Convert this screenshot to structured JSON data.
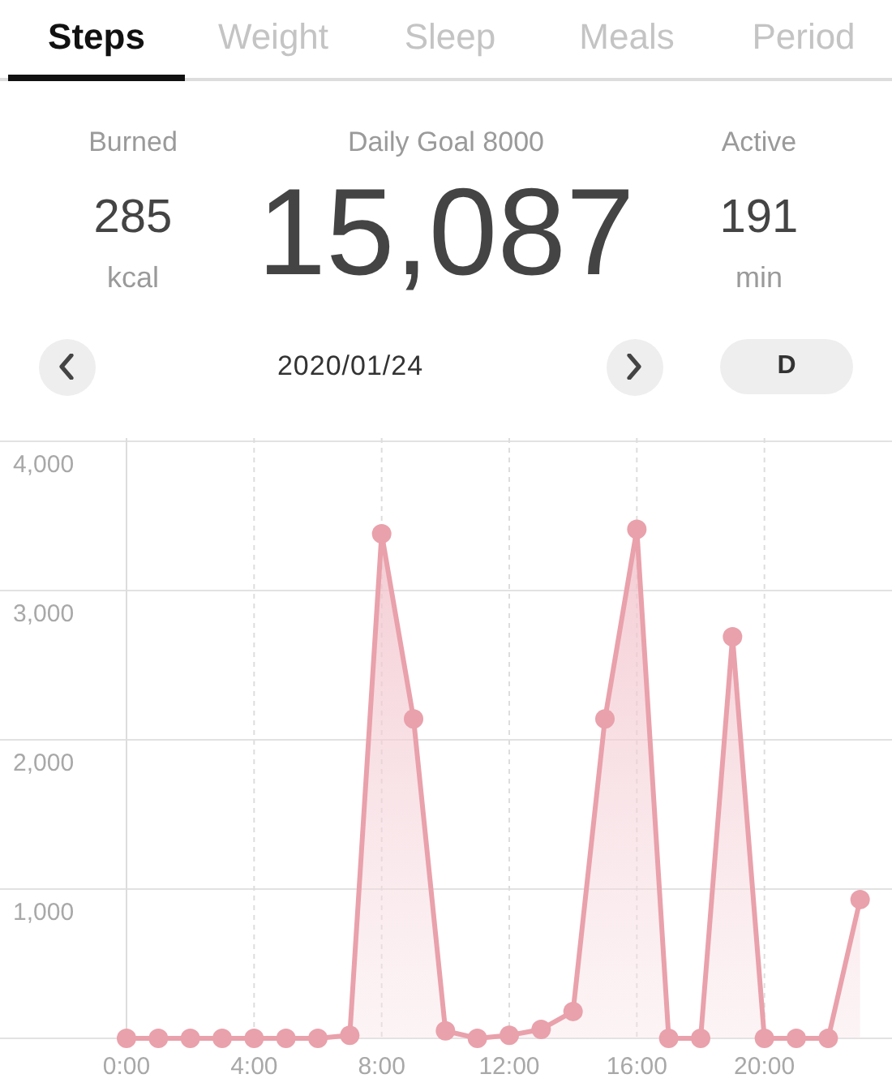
{
  "tabs": [
    {
      "label": "Steps",
      "selected": true
    },
    {
      "label": "Weight",
      "selected": false
    },
    {
      "label": "Sleep",
      "selected": false
    },
    {
      "label": "Meals",
      "selected": false
    },
    {
      "label": "Period",
      "selected": false
    }
  ],
  "stats": {
    "burned": {
      "label": "Burned",
      "value": "285",
      "unit": "kcal"
    },
    "goal": {
      "label": "Daily Goal 8000",
      "value": "15,087"
    },
    "active": {
      "label": "Active",
      "value": "191",
      "unit": "min"
    }
  },
  "date_nav": {
    "date": "2020/01/24",
    "period": "D"
  },
  "chart_data": {
    "type": "area",
    "grid": true,
    "x": [
      0,
      1,
      2,
      3,
      4,
      5,
      6,
      7,
      8,
      9,
      10,
      11,
      12,
      13,
      14,
      15,
      16,
      17,
      18,
      19,
      20,
      21,
      22,
      23
    ],
    "xlim": [
      0,
      24
    ],
    "ylim": [
      0,
      4000
    ],
    "xticks": [
      {
        "value": 0,
        "label": "0:00"
      },
      {
        "value": 4,
        "label": "4:00"
      },
      {
        "value": 8,
        "label": "8:00"
      },
      {
        "value": 12,
        "label": "12:00"
      },
      {
        "value": 16,
        "label": "16:00"
      },
      {
        "value": 20,
        "label": "20:00"
      }
    ],
    "yticks": [
      {
        "value": 1000,
        "label": "1,000"
      },
      {
        "value": 2000,
        "label": "2,000"
      },
      {
        "value": 3000,
        "label": "3,000"
      },
      {
        "value": 4000,
        "label": "4,000"
      }
    ],
    "series": [
      {
        "color": "#e9a1ab",
        "values": [
          0,
          0,
          0,
          0,
          0,
          0,
          0,
          20,
          3380,
          2140,
          50,
          0,
          20,
          60,
          180,
          2140,
          3410,
          0,
          0,
          2690,
          0,
          0,
          0,
          930
        ]
      }
    ]
  }
}
